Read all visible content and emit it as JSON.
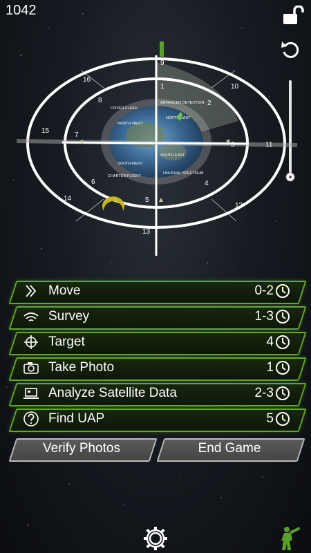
{
  "score": "1042",
  "actions": [
    {
      "label": "Move",
      "cost": "0-2",
      "icon": "chevron-arrows-icon"
    },
    {
      "label": "Survey",
      "cost": "1-3",
      "icon": "wifi-waves-icon"
    },
    {
      "label": "Target",
      "cost": "4",
      "icon": "crosshair-icon"
    },
    {
      "label": "Take Photo",
      "cost": "1",
      "icon": "camera-icon"
    },
    {
      "label": "Analyze Satellite Data",
      "cost": "2-3",
      "icon": "laptop-icon"
    },
    {
      "label": "Find UAP",
      "cost": "5",
      "icon": "question-circle-icon"
    }
  ],
  "buttons": {
    "verify": "Verify Photos",
    "end": "End Game"
  },
  "board": {
    "outer_numbers": [
      "9",
      "10",
      "11",
      "12",
      "13",
      "14",
      "15",
      "16"
    ],
    "inner_numbers": [
      "1",
      "2",
      "3",
      "4",
      "5",
      "6",
      "7",
      "8"
    ],
    "center_labels": [
      "ADVANCED DETECTION",
      "NORTH EAST",
      "SOUTH EAST",
      "UNUSUAL SPECTRUM",
      "SOUTH WEST",
      "CHARTER FLIGHT",
      "NORTH WEST",
      "COVER FLASH"
    ],
    "accent": "#c9b520"
  },
  "colors": {
    "button_border": "#63a829",
    "button_fill": "#14210c",
    "gray_border": "#bdbdbd"
  }
}
